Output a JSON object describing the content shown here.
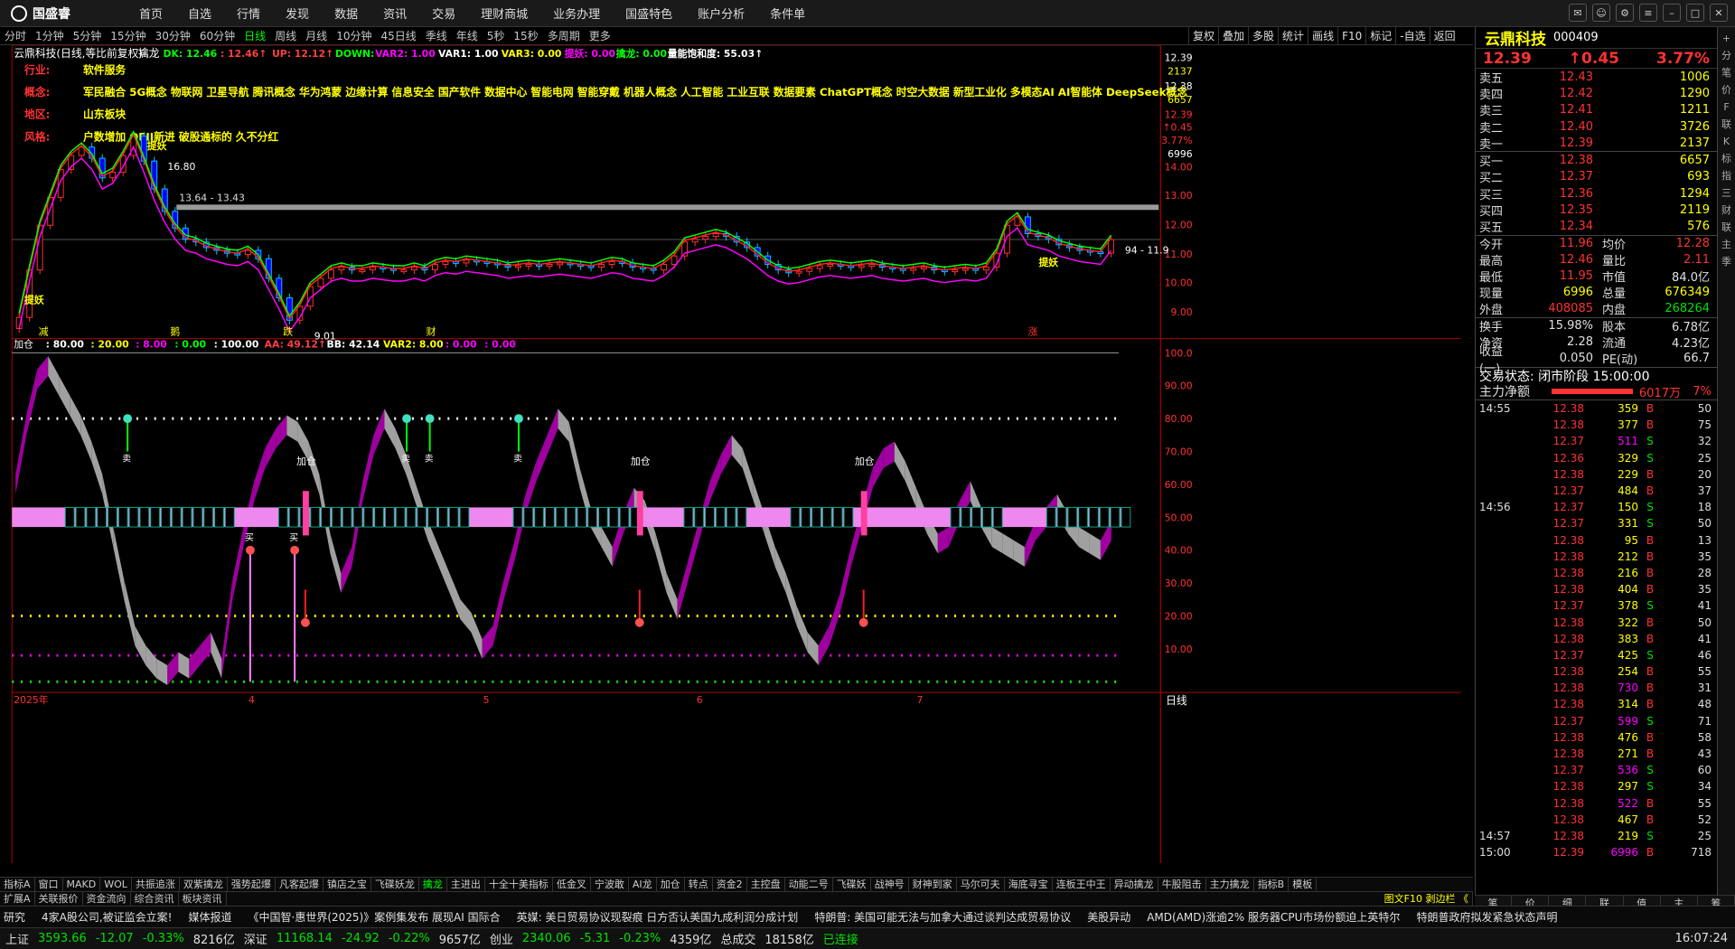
{
  "app": {
    "brand": "国盛睿"
  },
  "menu": [
    "首页",
    "自选",
    "行情",
    "发现",
    "数据",
    "资讯",
    "交易",
    "理财商城",
    "业务办理",
    "国盛特色",
    "账户分析",
    "条件单"
  ],
  "timeframes": [
    "分时",
    "1分钟",
    "5分钟",
    "15分钟",
    "30分钟",
    "60分钟",
    "日线",
    "周线",
    "月线",
    "10分钟",
    "45日线",
    "季线",
    "年线",
    "5秒",
    "15秒",
    "多周期",
    "更多"
  ],
  "active_timeframe": "日线",
  "toolbar_right": [
    "复权",
    "叠加",
    "多股",
    "统计",
    "画线",
    "F10",
    "标记",
    "-自选",
    "返回"
  ],
  "chart_title": "云鼎科技(日线,等比前复权)",
  "indicator_name": "擒龙",
  "indicator_vals": [
    {
      "t": "DK: 12.46",
      "c": "#00ff00"
    },
    {
      "t": ": 12.46↑",
      "c": "#ff4040"
    },
    {
      "t": "UP: 12.12↑",
      "c": "#ff4040"
    },
    {
      "t": "DOWN: ",
      "c": "#00ff00"
    },
    {
      "t": "VAR2: 1.00",
      "c": "#ff00ff"
    },
    {
      "t": "VAR1: 1.00",
      "c": "#ffffff"
    },
    {
      "t": "VAR3: 0.00",
      "c": "#ffff00"
    },
    {
      "t": "提妖: 0.00",
      "c": "#ff00ff"
    },
    {
      "t": "擒龙: 0.00",
      "c": "#00ff00"
    },
    {
      "t": "量能饱和度: 55.03↑",
      "c": "#ffffff"
    }
  ],
  "info": {
    "industry_label": "行业:",
    "industry": "软件服务",
    "concept_label": "概念:",
    "concept": "军民融合 5G概念 物联网 卫星导航 腾讯概念 华为鸿蒙 边缘计算 信息安全 国产软件 数据中心 智能电网 智能穿戴 机器人概念 人工智能 工业互联 数据要素 ChatGPT概念 时空大数据 新型工业化 多模态AI AI智能体 DeepSeek概念",
    "region_label": "地区:",
    "region": "山东板块",
    "style_label": "风格:",
    "style": "户数增加 QFII新进 破股通标的 久不分红"
  },
  "price_axis": [
    "12.39",
    "2137",
    "12.38",
    "6657",
    "12.39",
    "↑0.45",
    "3.77%",
    "6996",
    "14.00",
    "13.00",
    "12.00",
    "11.00",
    "10.00",
    "9.00"
  ],
  "annotations": {
    "hi": "16.80",
    "lo": "9.01",
    "range": "13.64 - 13.43",
    "r2": "94 - 11.9",
    "tag": "提妖"
  },
  "markers": [
    "减",
    "鹅",
    "跌",
    "财",
    "涨"
  ],
  "lower_title": "加仓",
  "lower_vals": [
    {
      "t": ": 80.00",
      "c": "#ffffff"
    },
    {
      "t": ": 20.00",
      "c": "#ffff00"
    },
    {
      "t": ": 8.00",
      "c": "#ff00ff"
    },
    {
      "t": ": 0.00",
      "c": "#00ff00"
    },
    {
      "t": ": 100.00",
      "c": "#ffffff"
    },
    {
      "t": "AA: 49.12↑",
      "c": "#ff4040"
    },
    {
      "t": "BB: 42.14",
      "c": "#ffffff"
    },
    {
      "t": "VAR2: 8.00",
      "c": "#ffff00"
    },
    {
      "t": ": 0.00",
      "c": "#ff00ff"
    },
    {
      "t": ": 0.00",
      "c": "#ff00ff"
    }
  ],
  "lower_axis": [
    "100.0",
    "90.00",
    "80.00",
    "70.00",
    "60.00",
    "50.00",
    "40.00",
    "30.00",
    "20.00",
    "10.00"
  ],
  "lower_labels": {
    "add": "加仓",
    "sell": "卖",
    "buy": "买"
  },
  "dates": [
    "2025年",
    "4",
    "5",
    "6",
    "7"
  ],
  "period_label": "日线",
  "stock": {
    "name": "云鼎科技",
    "code": "000409",
    "price": "12.39",
    "change": "↑0.45",
    "pct": "3.77%"
  },
  "asks": [
    {
      "l": "卖五",
      "p": "12.43",
      "v": "1006"
    },
    {
      "l": "卖四",
      "p": "12.42",
      "v": "1290"
    },
    {
      "l": "卖三",
      "p": "12.41",
      "v": "1211"
    },
    {
      "l": "卖二",
      "p": "12.40",
      "v": "3726"
    },
    {
      "l": "卖一",
      "p": "12.39",
      "v": "2137"
    }
  ],
  "bids": [
    {
      "l": "买一",
      "p": "12.38",
      "v": "6657"
    },
    {
      "l": "买二",
      "p": "12.37",
      "v": "693"
    },
    {
      "l": "买三",
      "p": "12.36",
      "v": "1294"
    },
    {
      "l": "买四",
      "p": "12.35",
      "v": "2119"
    },
    {
      "l": "买五",
      "p": "12.34",
      "v": "576"
    }
  ],
  "stats": [
    {
      "k": "今开",
      "a": "11.96",
      "ac": "red",
      "k2": "均价",
      "b": "12.28",
      "bc": "red"
    },
    {
      "k": "最高",
      "a": "12.46",
      "ac": "red",
      "k2": "量比",
      "b": "2.11",
      "bc": "red"
    },
    {
      "k": "最低",
      "a": "11.95",
      "ac": "red",
      "k2": "市值",
      "b": "84.0亿",
      "bc": "white"
    },
    {
      "k": "现量",
      "a": "6996",
      "ac": "yellow",
      "k2": "总量",
      "b": "676349",
      "bc": "yellow"
    },
    {
      "k": "外盘",
      "a": "408085",
      "ac": "red",
      "k2": "内盘",
      "b": "268264",
      "bc": "green"
    }
  ],
  "stats2": [
    {
      "k": "换手",
      "a": "15.98%",
      "k2": "股本",
      "b": "6.78亿"
    },
    {
      "k": "净资",
      "a": "2.28",
      "k2": "流通",
      "b": "4.23亿"
    },
    {
      "k": "收益(一)",
      "a": "0.050",
      "k2": "PE(动)",
      "b": "66.7"
    }
  ],
  "trade_status": "交易状态: 闭市阶段 15:00:00",
  "main_net": {
    "label": "主力净额",
    "value": "6017万",
    "pct": "7%"
  },
  "ticks": [
    {
      "t": "14:55",
      "p": "12.38",
      "v": "359",
      "s": "B",
      "n": "50"
    },
    {
      "t": "",
      "p": "12.38",
      "v": "377",
      "s": "B",
      "n": "75"
    },
    {
      "t": "",
      "p": "12.37",
      "v": "511",
      "s": "S",
      "n": "32"
    },
    {
      "t": "",
      "p": "12.36",
      "v": "329",
      "s": "S",
      "n": "25"
    },
    {
      "t": "",
      "p": "12.38",
      "v": "229",
      "s": "B",
      "n": "20"
    },
    {
      "t": "",
      "p": "12.37",
      "v": "484",
      "s": "B",
      "n": "37"
    },
    {
      "t": "14:56",
      "p": "12.37",
      "v": "150",
      "s": "S",
      "n": "18"
    },
    {
      "t": "",
      "p": "12.37",
      "v": "331",
      "s": "S",
      "n": "50"
    },
    {
      "t": "",
      "p": "12.38",
      "v": "95",
      "s": "B",
      "n": "13"
    },
    {
      "t": "",
      "p": "12.38",
      "v": "212",
      "s": "B",
      "n": "35"
    },
    {
      "t": "",
      "p": "12.38",
      "v": "216",
      "s": "B",
      "n": "28"
    },
    {
      "t": "",
      "p": "12.38",
      "v": "404",
      "s": "B",
      "n": "35"
    },
    {
      "t": "",
      "p": "12.37",
      "v": "378",
      "s": "S",
      "n": "41"
    },
    {
      "t": "",
      "p": "12.38",
      "v": "322",
      "s": "B",
      "n": "50"
    },
    {
      "t": "",
      "p": "12.38",
      "v": "383",
      "s": "B",
      "n": "41"
    },
    {
      "t": "",
      "p": "12.37",
      "v": "425",
      "s": "S",
      "n": "46"
    },
    {
      "t": "",
      "p": "12.38",
      "v": "254",
      "s": "B",
      "n": "55"
    },
    {
      "t": "",
      "p": "12.38",
      "v": "730",
      "s": "B",
      "n": "31"
    },
    {
      "t": "",
      "p": "12.38",
      "v": "314",
      "s": "B",
      "n": "48"
    },
    {
      "t": "",
      "p": "12.37",
      "v": "599",
      "s": "S",
      "n": "71"
    },
    {
      "t": "",
      "p": "12.38",
      "v": "476",
      "s": "B",
      "n": "58"
    },
    {
      "t": "",
      "p": "12.38",
      "v": "271",
      "s": "B",
      "n": "43"
    },
    {
      "t": "",
      "p": "12.37",
      "v": "536",
      "s": "S",
      "n": "60"
    },
    {
      "t": "",
      "p": "12.38",
      "v": "297",
      "s": "S",
      "n": "34"
    },
    {
      "t": "",
      "p": "12.38",
      "v": "522",
      "s": "B",
      "n": "55"
    },
    {
      "t": "",
      "p": "12.38",
      "v": "467",
      "s": "B",
      "n": "52"
    },
    {
      "t": "14:57",
      "p": "12.38",
      "v": "219",
      "s": "S",
      "n": "25"
    },
    {
      "t": "15:00",
      "p": "12.39",
      "v": "6996",
      "s": "B",
      "n": "718"
    }
  ],
  "bottom_tabs": [
    "笔",
    "价",
    "细",
    "联",
    "值",
    "主",
    "筹"
  ],
  "side_tabs": [
    "+",
    "分",
    "笔",
    "价",
    "F",
    "联",
    "K",
    "标",
    "指",
    "三",
    "财",
    "联",
    "主",
    "季"
  ],
  "ind_tabs": [
    "指标A",
    "窗口",
    "MAKD",
    "WOL",
    "共振追涨",
    "双紫擒龙",
    "强势起爆",
    "凡客起爆",
    "镇店之宝",
    "飞碟妖龙",
    "擒龙",
    "主进出",
    "十全十美指标",
    "低金叉",
    "宁波敢",
    "AI龙",
    "加仓",
    "转点",
    "资金2",
    "主控盘",
    "动能二号",
    "飞碟妖",
    "战神号",
    "财神到家",
    "马尔可夫",
    "海底寻宝",
    "连板王中王",
    "异动擒龙",
    "牛股阻击",
    "主力擒龙",
    "指标B",
    "模板"
  ],
  "ind_active": "擒龙",
  "row2_tabs": [
    "扩展A",
    "关联报价",
    "资金流向",
    "综合资讯",
    "板块资讯"
  ],
  "row2_right": "图文F10 剥边栏 《",
  "news": [
    "研究",
    "4家A股公司,被证监会立案!",
    "媒体报道",
    "《中国智·惠世界(2025)》案例集发布 展现AI 国际合",
    "英媒: 美日贸易协议现裂痕 日方否认美国九成利润分成计划",
    "特朗普: 美国可能无法与加拿大通过谈判达成贸易协议",
    "美股异动",
    "AMD(AMD)涨逾2% 服务器CPU市场份额迫上英特尔",
    "特朗普政府拟发紧急状态声明"
  ],
  "statusbar": [
    {
      "l": "上证",
      "v": "3593.66",
      "c": "-12.07",
      "p": "-0.33%",
      "a": "8216亿"
    },
    {
      "l": "深证",
      "v": "11168.14",
      "c": "-24.92",
      "p": "-0.22%",
      "a": "9657亿"
    },
    {
      "l": "创业",
      "v": "2340.06",
      "c": "-5.31",
      "p": "-0.23%",
      "a": "4359亿"
    }
  ],
  "total_label": "总成交",
  "total": "18158亿",
  "conn": "已连接",
  "clock": "16:07:24"
}
